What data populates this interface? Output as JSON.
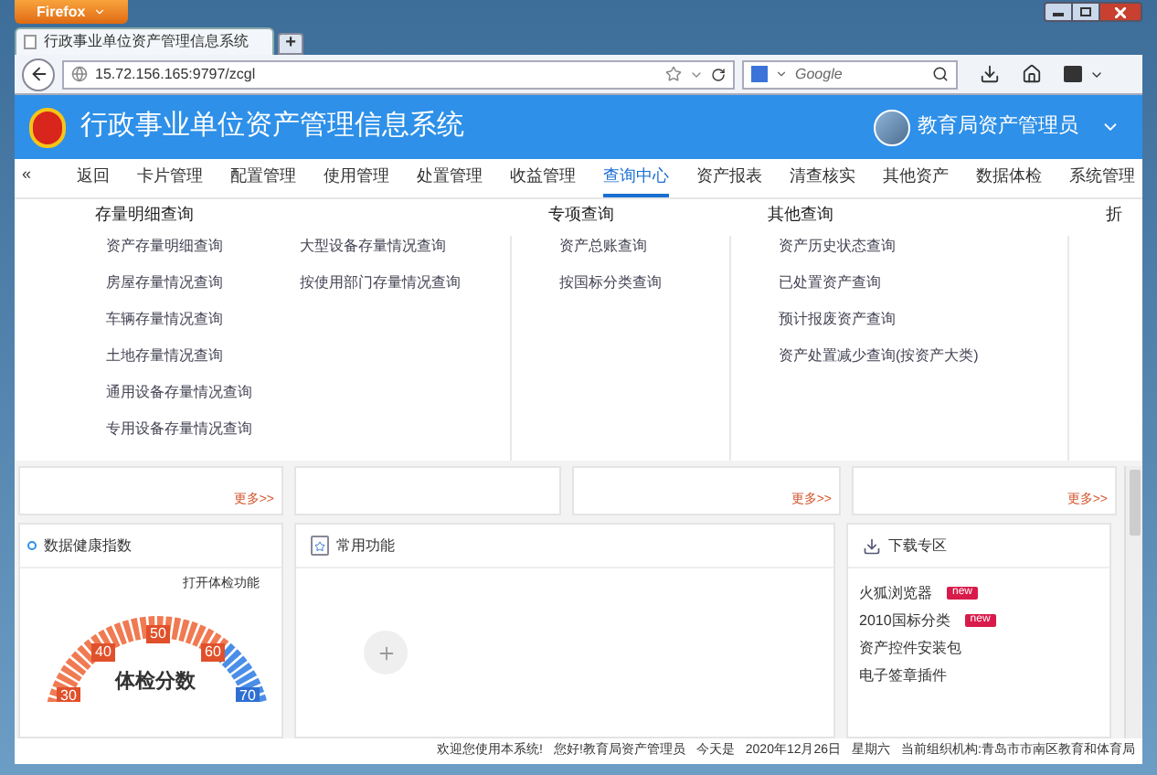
{
  "browser": {
    "menu_button": "Firefox",
    "tab_title": "行政事业单位资产管理信息系统",
    "new_tab": "+",
    "address": "15.72.156.165:9797/zcgl",
    "search_placeholder": "Google"
  },
  "header": {
    "title": "行政事业单位资产管理信息系统",
    "user": "教育局资产管理员"
  },
  "nav": {
    "collapse": "«",
    "items": [
      {
        "label": "返回",
        "selected": false
      },
      {
        "label": "卡片管理",
        "selected": false
      },
      {
        "label": "配置管理",
        "selected": false
      },
      {
        "label": "使用管理",
        "selected": false
      },
      {
        "label": "处置管理",
        "selected": false
      },
      {
        "label": "收益管理",
        "selected": false
      },
      {
        "label": "查询中心",
        "selected": true
      },
      {
        "label": "资产报表",
        "selected": false
      },
      {
        "label": "清查核实",
        "selected": false
      },
      {
        "label": "其他资产",
        "selected": false
      },
      {
        "label": "数据体检",
        "selected": false
      },
      {
        "label": "系统管理",
        "selected": false
      }
    ]
  },
  "menu": {
    "groups": [
      {
        "title": "存量明细查询",
        "columns": [
          [
            "资产存量明细查询",
            "房屋存量情况查询",
            "车辆存量情况查询",
            "土地存量情况查询",
            "通用设备存量情况查询",
            "专用设备存量情况查询"
          ],
          [
            "大型设备存量情况查询",
            "按使用部门存量情况查询"
          ]
        ]
      },
      {
        "title": "专项查询",
        "columns": [
          [
            "资产总账查询",
            "按国标分类查询"
          ]
        ]
      },
      {
        "title": "其他查询",
        "columns": [
          [
            "资产历史状态查询",
            "已处置资产查询",
            "预计报废资产查询",
            "资产处置减少查询(按资产大类)"
          ]
        ]
      }
    ],
    "cut_title": "折"
  },
  "cards": [
    {
      "kind": "more",
      "more": "更多>>"
    },
    {
      "kind": "blank"
    },
    {
      "kind": "more",
      "more": "更多>>"
    },
    {
      "kind": "more",
      "more": "更多>>"
    }
  ],
  "health": {
    "title": "数据健康指数",
    "link": "打开体检功能",
    "gauge_labels": [
      "30",
      "40",
      "50",
      "60",
      "70"
    ],
    "score_label": "体检分数"
  },
  "common": {
    "title": "常用功能"
  },
  "downloads": {
    "title": "下载专区",
    "items": [
      {
        "label": "火狐浏览器",
        "badge": "new"
      },
      {
        "label": "2010国标分类",
        "badge": "new"
      },
      {
        "label": "资产控件安装包"
      },
      {
        "label": "电子签章插件"
      }
    ]
  },
  "footer": [
    "欢迎您使用本系统!",
    "您好!教育局资产管理员",
    "今天是",
    "2020年12月26日",
    "星期六",
    "当前组织机构:青岛市市南区教育和体育局"
  ]
}
